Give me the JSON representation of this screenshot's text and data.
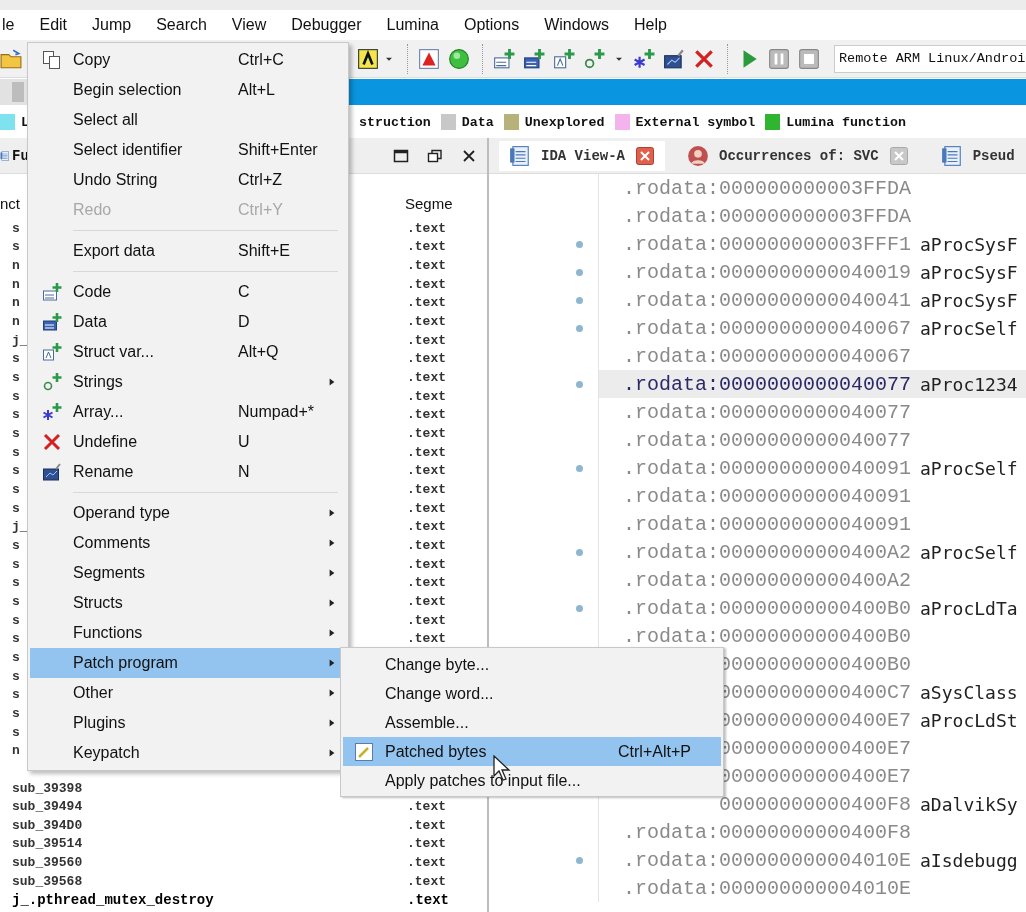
{
  "menubar": [
    "le",
    "Edit",
    "Jump",
    "Search",
    "View",
    "Debugger",
    "Lumina",
    "Options",
    "Windows",
    "Help"
  ],
  "toolbar": {
    "target": "Remote ARM Linux/Androi"
  },
  "legend": [
    {
      "label": "L",
      "color": "#7fe3ef"
    },
    {
      "label": "struction"
    },
    {
      "label": "Data",
      "color": "#c8c8c8"
    },
    {
      "label": "Unexplored",
      "color": "#b6b27a"
    },
    {
      "label": "External symbol",
      "color": "#f5b3ee"
    },
    {
      "label": "Lumina function",
      "color": "#2fb52f"
    }
  ],
  "functions_panel": {
    "tab": "Fu",
    "columns": [
      "nct",
      "Segme"
    ],
    "rows": [
      {
        "name": "s",
        "segment": ".text",
        "bold": false
      },
      {
        "name": "s",
        "segment": ".text",
        "bold": false
      },
      {
        "name": "n",
        "segment": ".text",
        "bold": false
      },
      {
        "name": "n",
        "segment": ".text",
        "bold": false
      },
      {
        "name": "n",
        "segment": ".text",
        "bold": false
      },
      {
        "name": "n",
        "segment": ".text",
        "bold": false
      },
      {
        "name": "j_",
        "segment": ".text",
        "bold": false
      },
      {
        "name": "s",
        "segment": ".text",
        "bold": false
      },
      {
        "name": "s",
        "segment": ".text",
        "bold": false
      },
      {
        "name": "s",
        "segment": ".text",
        "bold": false
      },
      {
        "name": "s",
        "segment": ".text",
        "bold": false
      },
      {
        "name": "s",
        "segment": ".text",
        "bold": false
      },
      {
        "name": "s",
        "segment": ".text",
        "bold": false
      },
      {
        "name": "s",
        "segment": ".text",
        "bold": false
      },
      {
        "name": "s",
        "segment": ".text",
        "bold": false
      },
      {
        "name": "s",
        "segment": ".text",
        "bold": false
      },
      {
        "name": "j_",
        "segment": ".text",
        "bold": false
      },
      {
        "name": "s",
        "segment": ".text",
        "bold": false
      },
      {
        "name": "s",
        "segment": ".text",
        "bold": false
      },
      {
        "name": "s",
        "segment": ".text",
        "bold": false
      },
      {
        "name": "s",
        "segment": ".text",
        "bold": false
      },
      {
        "name": "s",
        "segment": ".text",
        "bold": false
      },
      {
        "name": "s",
        "segment": ".text",
        "bold": false
      },
      {
        "name": "s",
        "bold": false
      },
      {
        "name": "s",
        "bold": false
      },
      {
        "name": "s",
        "bold": false
      },
      {
        "name": "s",
        "bold": false
      },
      {
        "name": "s",
        "bold": false
      },
      {
        "name": "n",
        "bold": false
      },
      {},
      {
        "name": "sub_39398",
        "bold": false
      },
      {
        "name": "sub_39494",
        "segment": ".text",
        "bold": false
      },
      {
        "name": "sub_394D0",
        "segment": ".text",
        "bold": false
      },
      {
        "name": "sub_39514",
        "segment": ".text",
        "bold": false
      },
      {
        "name": "sub_39560",
        "segment": ".text",
        "bold": false
      },
      {
        "name": "sub_39568",
        "segment": ".text",
        "bold": false
      },
      {
        "name": "j_.pthread_mutex_destroy",
        "segment": ".text",
        "bold": true
      }
    ]
  },
  "view_tabs": [
    {
      "label": "IDA View-A",
      "selected": true,
      "closable": true
    },
    {
      "label": "Occurrences of: SVC",
      "selected": false,
      "closable": true
    },
    {
      "label": "Pseud",
      "selected": false,
      "closable": false
    }
  ],
  "listing": [
    {
      "prefix": ".rodata:",
      "address": "000000000003FFDA",
      "dot": false,
      "selected": false
    },
    {
      "prefix": ".rodata:",
      "address": "000000000003FFDA",
      "dot": false,
      "selected": false
    },
    {
      "prefix": ".rodata:",
      "address": "000000000003FFF1",
      "label": "aProcSysF",
      "dot": true,
      "selected": false
    },
    {
      "prefix": ".rodata:",
      "address": "0000000000040019",
      "label": "aProcSysF",
      "dot": true,
      "selected": false
    },
    {
      "prefix": ".rodata:",
      "address": "0000000000040041",
      "label": "aProcSysF",
      "dot": true,
      "selected": false
    },
    {
      "prefix": ".rodata:",
      "address": "0000000000040067",
      "label": "aProcSelf",
      "dot": true,
      "selected": false
    },
    {
      "prefix": ".rodata:",
      "address": "0000000000040067",
      "dot": false,
      "selected": false
    },
    {
      "prefix": ".rodata:",
      "address": "0000000000040077",
      "label": "aProc1234",
      "dot": true,
      "selected": true
    },
    {
      "prefix": ".rodata:",
      "address": "0000000000040077",
      "dot": false,
      "selected": false
    },
    {
      "prefix": ".rodata:",
      "address": "0000000000040077",
      "dot": false,
      "selected": false
    },
    {
      "prefix": ".rodata:",
      "address": "0000000000040091",
      "label": "aProcSelf",
      "dot": true,
      "selected": false
    },
    {
      "prefix": ".rodata:",
      "address": "0000000000040091",
      "dot": false,
      "selected": false
    },
    {
      "prefix": ".rodata:",
      "address": "0000000000040091",
      "dot": false,
      "selected": false
    },
    {
      "prefix": ".rodata:",
      "address": "00000000000400A2",
      "label": "aProcSelf",
      "dot": true,
      "selected": false
    },
    {
      "prefix": ".rodata:",
      "address": "00000000000400A2",
      "dot": false,
      "selected": false
    },
    {
      "prefix": ".rodata:",
      "address": "00000000000400B0",
      "label": "aProcLdTa",
      "dot": true,
      "selected": false
    },
    {
      "prefix": ".rodata:",
      "address": "00000000000400B0",
      "dot": false,
      "selected": false
    },
    {
      "address": "00000000000400B0",
      "dot": false,
      "selected": false
    },
    {
      "address": "00000000000400C7",
      "label": "aSysClass",
      "dot": false,
      "selected": false
    },
    {
      "address": "00000000000400E7",
      "label": "aProcLdSt",
      "dot": false,
      "selected": false
    },
    {
      "address": "00000000000400E7",
      "dot": false,
      "selected": false
    },
    {
      "address": "00000000000400E7",
      "dot": false,
      "selected": false
    },
    {
      "address": "00000000000400F8",
      "label": "aDalvikSy",
      "dot": false,
      "selected": false
    },
    {
      "prefix": ".rodata:",
      "address": "00000000000400F8",
      "dot": false,
      "selected": false
    },
    {
      "prefix": ".rodata:",
      "address": "000000000004010E",
      "label": "aIsdebugg",
      "dot": true,
      "selected": false
    },
    {
      "prefix": ".rodata:",
      "address": "000000000004010E",
      "dot": false,
      "selected": false
    }
  ],
  "edit_menu": [
    {
      "kind": "item",
      "label": "Copy",
      "shortcut": "Ctrl+C",
      "disabled": false,
      "submenu": false,
      "selected": false
    },
    {
      "kind": "item",
      "label": "Begin selection",
      "shortcut": "Alt+L",
      "disabled": false,
      "submenu": false,
      "selected": false
    },
    {
      "kind": "item",
      "label": "Select all",
      "disabled": false,
      "submenu": false,
      "selected": false
    },
    {
      "kind": "item",
      "label": "Select identifier",
      "shortcut": "Shift+Enter",
      "disabled": false,
      "submenu": false,
      "selected": false
    },
    {
      "kind": "item",
      "label": "Undo String",
      "shortcut": "Ctrl+Z",
      "disabled": false,
      "submenu": false,
      "selected": false
    },
    {
      "kind": "item",
      "label": "Redo",
      "shortcut": "Ctrl+Y",
      "disabled": true,
      "submenu": false,
      "selected": false
    },
    {
      "kind": "separator"
    },
    {
      "kind": "item",
      "label": "Export data",
      "shortcut": "Shift+E",
      "disabled": false,
      "submenu": false,
      "selected": false
    },
    {
      "kind": "separator"
    },
    {
      "kind": "item",
      "label": "Code",
      "shortcut": "C",
      "disabled": false,
      "submenu": false,
      "selected": false
    },
    {
      "kind": "item",
      "label": "Data",
      "shortcut": "D",
      "disabled": false,
      "submenu": false,
      "selected": false
    },
    {
      "kind": "item",
      "label": "Struct var...",
      "shortcut": "Alt+Q",
      "disabled": false,
      "submenu": false,
      "selected": false
    },
    {
      "kind": "item",
      "label": "Strings",
      "disabled": false,
      "submenu": true,
      "selected": false
    },
    {
      "kind": "item",
      "label": "Array...",
      "shortcut": "Numpad+*",
      "disabled": false,
      "submenu": false,
      "selected": false
    },
    {
      "kind": "item",
      "label": "Undefine",
      "shortcut": "U",
      "disabled": false,
      "submenu": false,
      "selected": false
    },
    {
      "kind": "item",
      "label": "Rename",
      "shortcut": "N",
      "disabled": false,
      "submenu": false,
      "selected": false
    },
    {
      "kind": "separator"
    },
    {
      "kind": "item",
      "label": "Operand type",
      "disabled": false,
      "submenu": true,
      "selected": false
    },
    {
      "kind": "item",
      "label": "Comments",
      "disabled": false,
      "submenu": true,
      "selected": false
    },
    {
      "kind": "item",
      "label": "Segments",
      "disabled": false,
      "submenu": true,
      "selected": false
    },
    {
      "kind": "item",
      "label": "Structs",
      "disabled": false,
      "submenu": true,
      "selected": false
    },
    {
      "kind": "item",
      "label": "Functions",
      "disabled": false,
      "submenu": true,
      "selected": false
    },
    {
      "kind": "item",
      "label": "Patch program",
      "disabled": false,
      "submenu": true,
      "selected": true
    },
    {
      "kind": "item",
      "label": "Other",
      "disabled": false,
      "submenu": true,
      "selected": false
    },
    {
      "kind": "item",
      "label": "Plugins",
      "disabled": false,
      "submenu": true,
      "selected": false
    },
    {
      "kind": "item",
      "label": "Keypatch",
      "disabled": false,
      "submenu": true,
      "selected": false
    }
  ],
  "patch_submenu": [
    {
      "label": "Change byte...",
      "selected": false
    },
    {
      "label": "Change word...",
      "selected": false
    },
    {
      "label": "Assemble...",
      "selected": false
    },
    {
      "label": "Patched bytes",
      "shortcut": "Ctrl+Alt+P",
      "selected": true
    },
    {
      "label": "Apply patches to input file...",
      "selected": false
    }
  ]
}
